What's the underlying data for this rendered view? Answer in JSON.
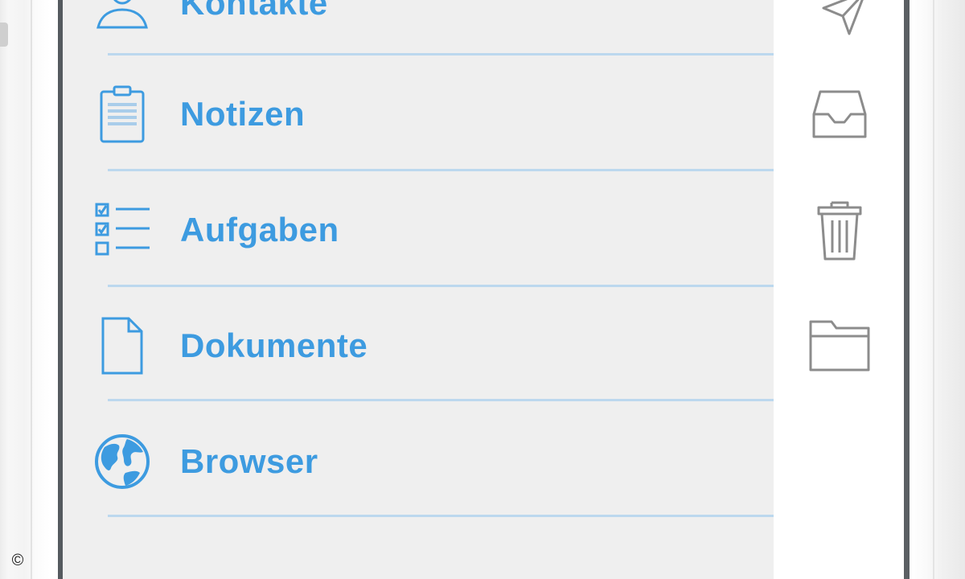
{
  "menu": {
    "items": [
      {
        "label": "Kontakte",
        "icon": "contacts-icon"
      },
      {
        "label": "Notizen",
        "icon": "notes-icon"
      },
      {
        "label": "Aufgaben",
        "icon": "tasks-icon"
      },
      {
        "label": "Dokumente",
        "icon": "document-icon"
      },
      {
        "label": "Browser",
        "icon": "globe-icon"
      }
    ]
  },
  "actions": [
    {
      "icon": "send-icon"
    },
    {
      "icon": "inbox-icon"
    },
    {
      "icon": "trash-icon"
    },
    {
      "icon": "folder-icon"
    }
  ],
  "copyright": "©",
  "colors": {
    "accent": "#3d9be0",
    "menu_background": "#efefef",
    "divider": "#bcd8ee",
    "rail_background": "#ffffff",
    "rail_icon": "#8c8c8c",
    "frame": "#5b5f63"
  }
}
